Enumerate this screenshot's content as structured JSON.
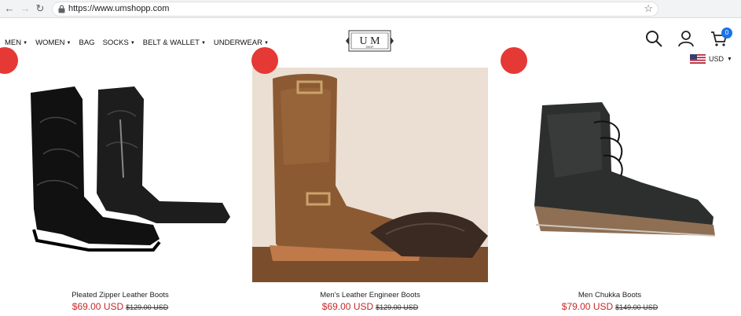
{
  "browser": {
    "url": "https://www.umshopp.com"
  },
  "header": {
    "menu": [
      {
        "label": "MEN",
        "has_dropdown": true
      },
      {
        "label": "WOMEN",
        "has_dropdown": true
      },
      {
        "label": "BAG",
        "has_dropdown": false
      },
      {
        "label": "SOCKS",
        "has_dropdown": true
      },
      {
        "label": "BELT & WALLET",
        "has_dropdown": true
      },
      {
        "label": "UNDERWEAR",
        "has_dropdown": true
      }
    ],
    "logo": {
      "main": "U M",
      "sub": "SHOP"
    },
    "cart_count": "0",
    "currency": "USD",
    "icons": [
      "search-icon",
      "user-icon",
      "cart-icon"
    ]
  },
  "products": [
    {
      "name": "Pleated Zipper Leather Boots",
      "price": "$69.00 USD",
      "compare_price": "$129.00 USD"
    },
    {
      "name": "Men's Leather Engineer Boots",
      "price": "$69.00 USD",
      "compare_price": "$129.00 USD"
    },
    {
      "name": "Men Chukka Boots",
      "price": "$79.00 USD",
      "compare_price": "$149.00 USD"
    }
  ],
  "colors": {
    "sale": "#e53935",
    "price": "#c62828",
    "badge": "#1a73e8"
  }
}
